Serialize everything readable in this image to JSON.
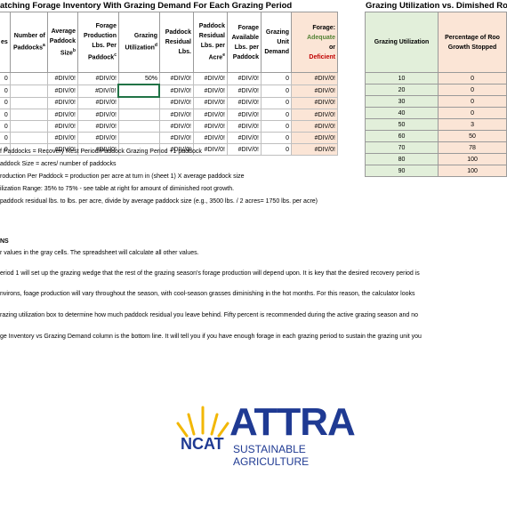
{
  "main_title": "atching Forage Inventory With Grazing Demand For Each Grazing Period",
  "side_title": "Grazing Utilization vs. Dimished Root Gr",
  "main_headers": [
    {
      "text": "es"
    },
    {
      "text": "Number of Paddocks",
      "sup": "a"
    },
    {
      "text": "Average Paddock Size",
      "sup": "b"
    },
    {
      "text": "Forage Production Lbs. Per Paddock",
      "sup": "c"
    },
    {
      "text": "Grazing Utilization",
      "sup": "d"
    },
    {
      "text": "Paddock Residual Lbs."
    },
    {
      "text": "Paddock Residual Lbs. per Acre",
      "sup": "e"
    },
    {
      "text": "Forage Available Lbs. per Paddock"
    },
    {
      "text": "Grazing Unit Demand"
    },
    {
      "text": "Forage:",
      "adequate": "Adequate",
      "or": "or",
      "deficient": "Deficient"
    }
  ],
  "main_rows": [
    [
      "0",
      "",
      "#DIV/0!",
      "#DIV/0!",
      "50%",
      "#DIV/0!",
      "#DIV/0!",
      "#DIV/0!",
      "0",
      "#DIV/0!"
    ],
    [
      "0",
      "",
      "#DIV/0!",
      "#DIV/0!",
      "",
      "#DIV/0!",
      "#DIV/0!",
      "#DIV/0!",
      "0",
      "#DIV/0!"
    ],
    [
      "0",
      "",
      "#DIV/0!",
      "#DIV/0!",
      "",
      "#DIV/0!",
      "#DIV/0!",
      "#DIV/0!",
      "0",
      "#DIV/0!"
    ],
    [
      "0",
      "",
      "#DIV/0!",
      "#DIV/0!",
      "",
      "#DIV/0!",
      "#DIV/0!",
      "#DIV/0!",
      "0",
      "#DIV/0!"
    ],
    [
      "0",
      "",
      "#DIV/0!",
      "#DIV/0!",
      "",
      "#DIV/0!",
      "#DIV/0!",
      "#DIV/0!",
      "0",
      "#DIV/0!"
    ],
    [
      "0",
      "",
      "#DIV/0!",
      "#DIV/0!",
      "",
      "#DIV/0!",
      "#DIV/0!",
      "#DIV/0!",
      "0",
      "#DIV/0!"
    ],
    [
      "0",
      "",
      "#DIV/0!",
      "#DIV/0!",
      "",
      "#DIV/0!",
      "#DIV/0!",
      "#DIV/0!",
      "0",
      "#DIV/0!"
    ]
  ],
  "side_headers": [
    "Grazing Utilization",
    "Percentage of Roo Growth Stopped"
  ],
  "side_rows": [
    [
      "10",
      "0"
    ],
    [
      "20",
      "0"
    ],
    [
      "30",
      "0"
    ],
    [
      "40",
      "0"
    ],
    [
      "50",
      "3"
    ],
    [
      "60",
      "50"
    ],
    [
      "70",
      "78"
    ],
    [
      "80",
      "100"
    ],
    [
      "90",
      "100"
    ]
  ],
  "notes": [
    "f Paddocks = Recovery Rest Period/Paddock Grazing Period +1 paddock",
    "addock Size = acres/ number of paddocks",
    "roduction Per Paddock = production per acre at turn in (sheet 1) X average paddock size",
    "ilization Range: 35% to 75% - see table at right  for amount of diminished root growth.",
    "paddock residual lbs. to lbs. per acre, divide by average paddock size (e.g., 3500 lbs. / 2 acres= 1750 lbs. per acre)"
  ],
  "instructions_heading": "NS",
  "instructions": [
    "r values in the gray cells.  The spreadsheet will calculate all other values.",
    "eriod 1 will set up the grazing wedge that the rest of the grazing season's forage production will depend upon. It is key that the desired recovery period is",
    "nvirons, foage production will vary throughout the season, with cool-season grasses diminishing in the hot months. For this reason, the calculator looks",
    "razing utilization box to determine how much paddock residual you leave behind. Fifty percent is recommended during the active grazing season and no",
    "ge Inventory vs Grazing  Demand column is the bottom line. It will tell you if you have enough forage in each grazing period to sustain the grazing unit you"
  ],
  "logo": {
    "attra": "ATTRA",
    "ncat": "NCAT",
    "tagline": "SUSTAINABLE AGRICULTURE",
    "colors": {
      "blue": "#1f3a93",
      "gold": "#f2b705"
    }
  }
}
